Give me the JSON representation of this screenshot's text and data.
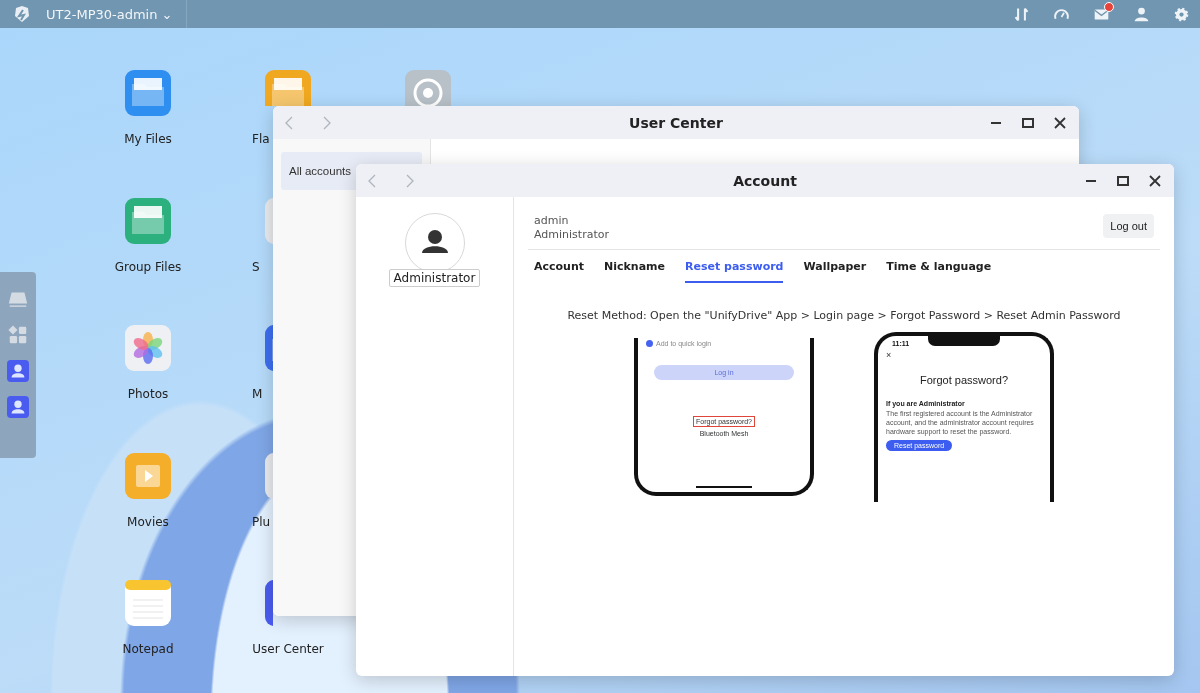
{
  "top_bar": {
    "device_name": "UT2-MP30-admin",
    "dropdown_glyph": "⌄",
    "mail_unread": true
  },
  "desktop_icons": [
    {
      "label": "My Files",
      "kind": "files"
    },
    {
      "label": "Fla",
      "kind": "flash"
    },
    {
      "kind": "settings"
    },
    {
      "label": "Group Files",
      "kind": "group"
    },
    {
      "label": "S",
      "kind": "blank"
    },
    {
      "label": "Photos",
      "kind": "photos"
    },
    {
      "label": "M",
      "kind": "bluefolder"
    },
    {
      "label": "Movies",
      "kind": "movies"
    },
    {
      "label": "Plu",
      "kind": "blank"
    },
    {
      "label": "Notepad",
      "kind": "notepad"
    },
    {
      "label": "User Center",
      "kind": "user"
    }
  ],
  "dock": [
    {
      "kind": "drive"
    },
    {
      "kind": "apps"
    },
    {
      "kind": "user"
    },
    {
      "kind": "user"
    }
  ],
  "user_center_window": {
    "title": "User Center",
    "sidebar": [
      {
        "label": "All accounts",
        "selected": true
      }
    ]
  },
  "account_window": {
    "title": "Account",
    "avatar_label": "Administrator",
    "username": "admin",
    "role": "Administrator",
    "logout": "Log out",
    "tabs": [
      {
        "label": "Account",
        "selected": false
      },
      {
        "label": "Nickname",
        "selected": false
      },
      {
        "label": "Reset password",
        "selected": true
      },
      {
        "label": "Wallpaper",
        "selected": false
      },
      {
        "label": "Time & language",
        "selected": false
      }
    ],
    "instruction": "Reset Method: Open the \"UnifyDrive\" App > Login page > Forgot Password > Reset Admin Password",
    "login_phone": {
      "quick_login": "Add to quick login",
      "login_button": "Log in",
      "forgot_link": "Forgot password?",
      "bluetooth": "Bluetooth Mesh"
    },
    "reset_phone": {
      "time": "11:11",
      "close": "×",
      "heading": "Forgot password?",
      "subheading": "If you are Administrator",
      "body": "The first registered account is the Administrator account, and the administrator account requires hardware support to reset the password.",
      "button": "Reset password"
    }
  }
}
